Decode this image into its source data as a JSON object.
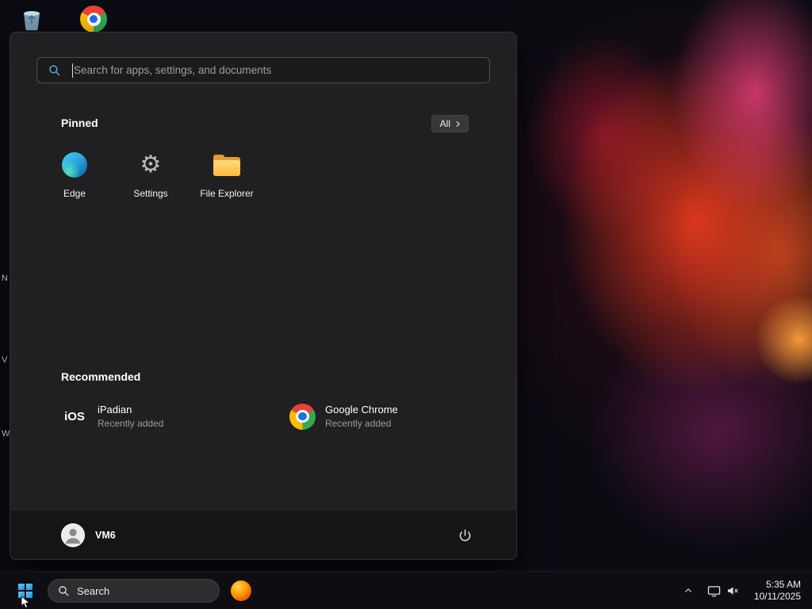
{
  "desktop": {
    "edge_labels": [
      "N",
      "V",
      "W"
    ]
  },
  "start_menu": {
    "search": {
      "placeholder": "Search for apps, settings, and documents"
    },
    "pinned": {
      "title": "Pinned",
      "all_button": "All",
      "apps": [
        {
          "name": "Edge"
        },
        {
          "name": "Settings"
        },
        {
          "name": "File Explorer"
        }
      ]
    },
    "recommended": {
      "title": "Recommended",
      "items": [
        {
          "name": "iPadian",
          "detail": "Recently added",
          "icon_text": "iOS"
        },
        {
          "name": "Google Chrome",
          "detail": "Recently added"
        }
      ]
    },
    "user": {
      "name": "VM6"
    }
  },
  "taskbar": {
    "search_label": "Search",
    "clock": {
      "time": "5:35 AM",
      "date": "10/11/2025"
    }
  },
  "icons": {
    "gear_glyph": "⚙"
  },
  "colors": {
    "accent_blue": "#2288d8",
    "menu_bg": "#212124",
    "taskbar_bg": "#0f0f13"
  }
}
